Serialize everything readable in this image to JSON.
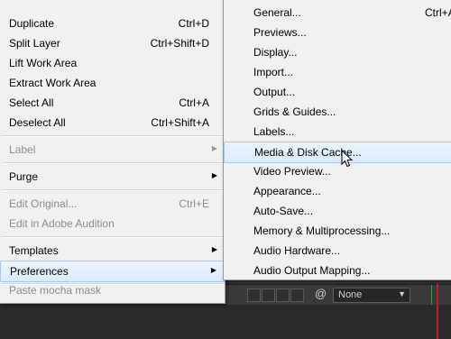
{
  "main_menu": {
    "items": [
      {
        "label": "Duplicate",
        "shortcut": "Ctrl+D"
      },
      {
        "label": "Split Layer",
        "shortcut": "Ctrl+Shift+D"
      },
      {
        "label": "Lift Work Area",
        "shortcut": ""
      },
      {
        "label": "Extract Work Area",
        "shortcut": ""
      },
      {
        "label": "Select All",
        "shortcut": "Ctrl+A"
      },
      {
        "label": "Deselect All",
        "shortcut": "Ctrl+Shift+A"
      },
      {
        "label": "Label",
        "shortcut": ""
      },
      {
        "label": "Purge",
        "shortcut": ""
      },
      {
        "label": "Edit Original...",
        "shortcut": "Ctrl+E"
      },
      {
        "label": "Edit in Adobe Audition",
        "shortcut": ""
      },
      {
        "label": "Templates",
        "shortcut": ""
      },
      {
        "label": "Preferences",
        "shortcut": ""
      },
      {
        "label": "Paste mocha mask",
        "shortcut": ""
      }
    ]
  },
  "preferences_submenu": {
    "items": [
      {
        "label": "General...",
        "shortcut": "Ctrl+A"
      },
      {
        "label": "Previews..."
      },
      {
        "label": "Display..."
      },
      {
        "label": "Import..."
      },
      {
        "label": "Output..."
      },
      {
        "label": "Grids & Guides..."
      },
      {
        "label": "Labels..."
      },
      {
        "label": "Media & Disk Cache..."
      },
      {
        "label": "Video Preview..."
      },
      {
        "label": "Appearance..."
      },
      {
        "label": "Auto-Save..."
      },
      {
        "label": "Memory & Multiprocessing..."
      },
      {
        "label": "Audio Hardware..."
      },
      {
        "label": "Audio Output Mapping..."
      }
    ]
  },
  "timeline_bar": {
    "dropdown_value": "None"
  },
  "colors": {
    "menu_bg": "#f0f0f0",
    "highlight_border": "#a8c8ec",
    "disabled_text": "#8d8d8d",
    "playhead": "#b0232a"
  }
}
